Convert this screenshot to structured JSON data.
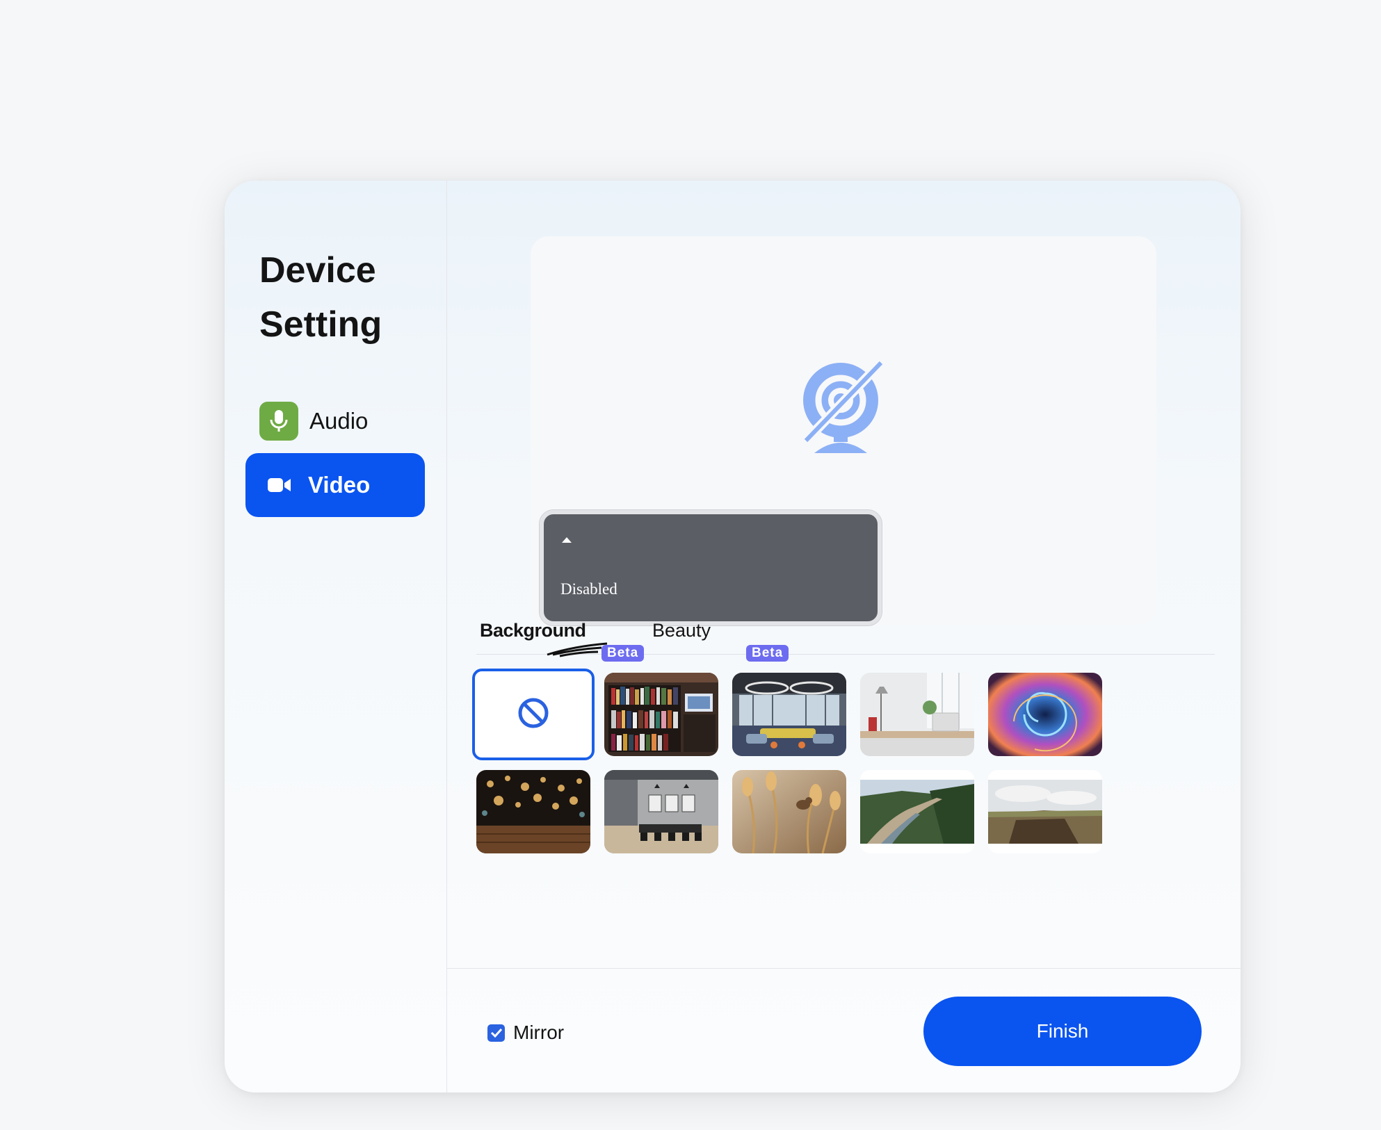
{
  "title_line1": "Device",
  "title_line2": "Setting",
  "nav": {
    "audio_label": "Audio",
    "video_label": "Video"
  },
  "preview": {
    "icon": "camera-off-icon"
  },
  "dropdown": {
    "value": "Disabled",
    "expanded": true
  },
  "tabs": {
    "background_label": "Background",
    "beauty_label": "Beauty",
    "badge_label": "Beta"
  },
  "backgrounds": [
    {
      "name": "none",
      "icon": "no-background-icon",
      "selected": true
    },
    {
      "name": "bookshelf"
    },
    {
      "name": "office-lounge"
    },
    {
      "name": "desk-workspace"
    },
    {
      "name": "abstract-swirl"
    },
    {
      "name": "bokeh-lights"
    },
    {
      "name": "meeting-room"
    },
    {
      "name": "bird-grass"
    },
    {
      "name": "river-valley"
    },
    {
      "name": "cliff-landscape"
    }
  ],
  "footer": {
    "mirror_label": "Mirror",
    "mirror_checked": true,
    "finish_label": "Finish"
  },
  "colors": {
    "primary": "#0a54f0",
    "audio_icon_bg": "#6fab44",
    "badge": "#6d6cf0",
    "dropdown_bg": "#5b5e65"
  }
}
